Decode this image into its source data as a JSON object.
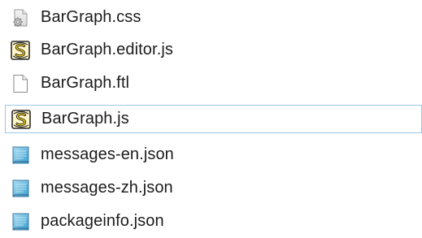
{
  "files": [
    {
      "name": "BarGraph.css",
      "icon": "css-file-icon",
      "selected": false
    },
    {
      "name": "BarGraph.editor.js",
      "icon": "js-script-file-icon",
      "selected": false
    },
    {
      "name": "BarGraph.ftl",
      "icon": "blank-file-icon",
      "selected": false
    },
    {
      "name": "BarGraph.js",
      "icon": "js-script-file-icon",
      "selected": true
    },
    {
      "name": "messages-en.json",
      "icon": "json-file-icon",
      "selected": false
    },
    {
      "name": "messages-zh.json",
      "icon": "json-file-icon",
      "selected": false
    },
    {
      "name": "packageinfo.json",
      "icon": "json-file-icon",
      "selected": false
    }
  ],
  "colors": {
    "selection_border": "#9ac6e8",
    "text": "#1b1b1b"
  }
}
